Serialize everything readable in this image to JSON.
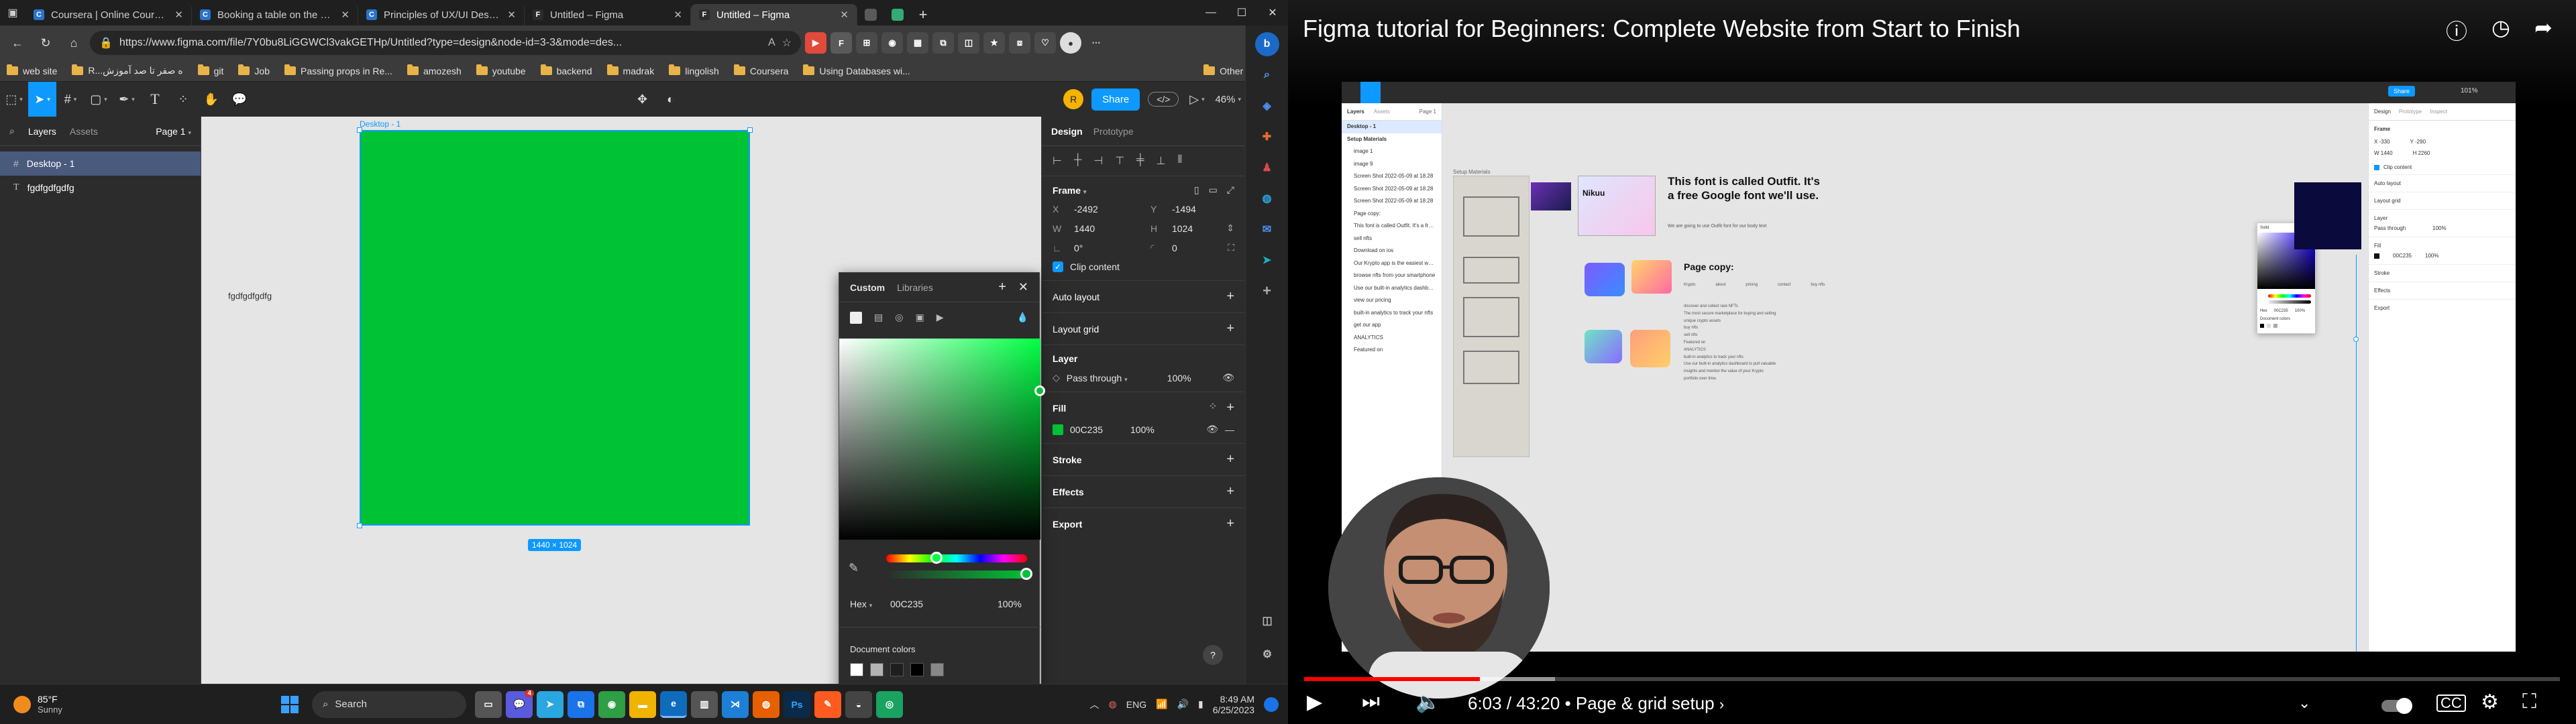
{
  "browser": {
    "tabs": [
      {
        "title": "Coursera | Online Courses & Cre",
        "favicon": "coursera-icon",
        "active": false
      },
      {
        "title": "Booking a table on the Little Lem",
        "favicon": "coursera-icon",
        "active": false
      },
      {
        "title": "Principles of UX/UI Design - How",
        "favicon": "coursera-icon",
        "active": false
      },
      {
        "title": "Untitled – Figma",
        "favicon": "figma-icon",
        "active": false
      },
      {
        "title": "Untitled – Figma",
        "favicon": "figma-icon",
        "active": true
      }
    ],
    "url": "https://www.figma.com/file/7Y0bu8LiGGWCl3vakGETHp/Untitled?type=design&node-id=3-3&mode=des...",
    "bookmarks": [
      "web site",
      "R...ه صفر تا صد آموزش",
      "git",
      "Job",
      "Passing props in Re...",
      "amozesh",
      "youtube",
      "backend",
      "madrak",
      "lingolish",
      "Coursera",
      "Using Databases wi..."
    ],
    "other_favorites": "Other favorites"
  },
  "figma": {
    "page_label": "Page 1",
    "share_label": "Share",
    "avatar_initial": "R",
    "zoom": "46%",
    "left_tabs": {
      "layers": "Layers",
      "assets": "Assets"
    },
    "layers": [
      {
        "name": "Desktop - 1",
        "selected": true
      },
      {
        "name": "fgdfgdfgdfg",
        "selected": false
      }
    ],
    "canvas": {
      "frame_label": "Desktop - 1",
      "frame_size": "1440 × 1024",
      "text_node": "fgdfgdfgdfg",
      "fill_color": "#00C235"
    },
    "right_tabs": {
      "design": "Design",
      "prototype": "Prototype"
    },
    "frame": {
      "title": "Frame",
      "x_label": "X",
      "x": "-2492",
      "y_label": "Y",
      "y": "-1494",
      "w_label": "W",
      "w": "1440",
      "h_label": "H",
      "h": "1024",
      "rotation": "0°",
      "radius": "0",
      "clip_content": "Clip content"
    },
    "sections": {
      "auto_layout": "Auto layout",
      "layout_grid": "Layout grid",
      "layer": "Layer",
      "blend": "Pass through",
      "opacity": "100%",
      "fill": "Fill",
      "fill_hex": "00C235",
      "fill_opacity": "100%",
      "stroke": "Stroke",
      "effects": "Effects",
      "export": "Export"
    },
    "picker": {
      "tab_custom": "Custom",
      "tab_libraries": "Libraries",
      "mode": "Hex",
      "hex": "00C235",
      "opacity": "100%",
      "doc_colors_label": "Document colors",
      "doc_colors": [
        "#ffffff",
        "#b3b3b3",
        "#1e1e1e",
        "#000000",
        "#888888"
      ]
    },
    "help": "?"
  },
  "taskbar": {
    "weather_temp": "85°F",
    "weather_text": "Sunny",
    "search": "Search",
    "lang": "ENG",
    "time": "8:49 AM",
    "date": "6/25/2023",
    "badge_count": "4"
  },
  "youtube": {
    "title": "Figma tutorial for Beginners: Complete Website from Start to Finish",
    "time": "6:03 / 43:20",
    "chapter": "• Page & grid setup",
    "progress": 0.14,
    "video": {
      "layers_tab": "Layers",
      "assets_tab": "Assets",
      "page": "Page 1",
      "layers": [
        "Desktop - 1",
        "Setup Materials",
        "image 1",
        "image 9",
        "Screen Shot 2022-05-09 at 18.28",
        "Screen Shot 2022-05-09 at 18.28",
        "Screen Shot 2022-05-09 at 18.28",
        "Page copy:",
        "This font is called Outfit. It's a free Google font...",
        "sell nfts",
        "Download on ios",
        "Our Krypto app is the easiest way to keep track...",
        "browse nfts from your smartphone",
        "Use our built-in analytics dashboard to pull valua...",
        "view our pricing",
        "built-in analytics to track your nfts",
        "get our app",
        "ANALYTICS",
        "Featured on"
      ],
      "setup_label": "Setup Materials",
      "font_heading": "This font is called Outfit. It's a free Google font we'll use.",
      "font_sub": "We are going to use Outfit font for our body text",
      "nikuu": "Nikuu",
      "page_copy": "Page copy:",
      "nav_items": [
        "Krypto",
        "about",
        "pricing",
        "contact",
        "buy nfts"
      ],
      "copy_lines": [
        "discover and collect rare NFTs",
        "The most secure marketplace for buying and selling unique crypto assets",
        "buy nfts",
        "sell nfts",
        "Featured on",
        "ANALYTICS",
        "built-in analytics to track your nfts",
        "Use our built-in analytics dashboard to pull valuable insights and monitor the value of your Krypto portfolio over time."
      ],
      "right_tabs": [
        "Design",
        "Prototype",
        "Inspect"
      ],
      "frame": "Frame",
      "x": "-330",
      "y": "-290",
      "w": "1440",
      "h": "2260",
      "clip": "Clip content",
      "sections": [
        "Auto layout",
        "Layout grid",
        "Layer",
        "Fill",
        "Stroke",
        "Effects",
        "Export"
      ],
      "blend": "Pass through",
      "blend_opacity": "100%",
      "fill_hex": "00C235",
      "fill_opacity": "100%",
      "picker_title": "Solid",
      "picker_hex_label": "Hex",
      "picker_hex": "00C235",
      "picker_opacity": "100%",
      "doc_colors": "Document colors",
      "zoom": "101%",
      "share": "Share"
    }
  },
  "icons": {
    "settings": "gear-icon",
    "play": "play-icon",
    "next": "next-icon",
    "volume": "volume-icon",
    "captions": "captions-icon",
    "fullscreen": "fullscreen-icon"
  }
}
